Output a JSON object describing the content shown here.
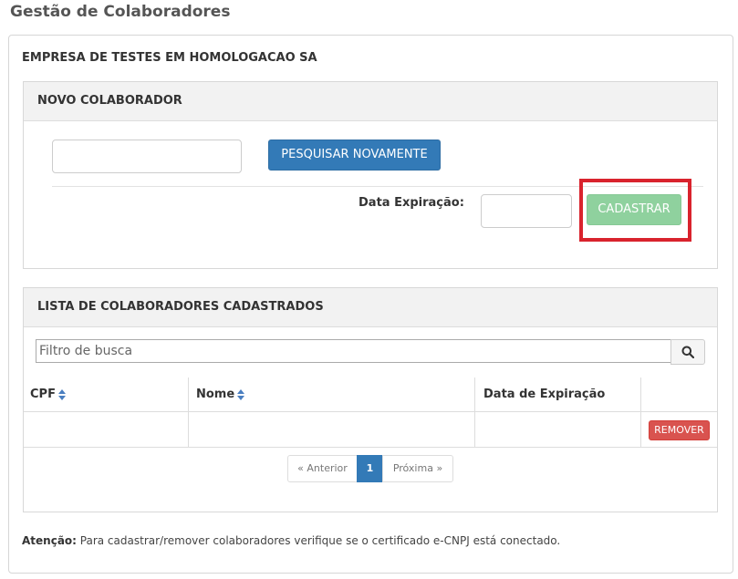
{
  "page": {
    "title": "Gestão de Colaboradores"
  },
  "company": {
    "name": "EMPRESA DE TESTES EM HOMOLOGACAO SA"
  },
  "new_collaborator": {
    "heading": "NOVO COLABORADOR",
    "search_value": "",
    "search_again_label": "PESQUISAR NOVAMENTE",
    "expiration_label": "Data Expiração:",
    "expiration_value": "",
    "register_label": "CADASTRAR"
  },
  "list": {
    "heading": "LISTA DE COLABORADORES CADASTRADOS",
    "filter_placeholder": "Filtro de busca",
    "columns": [
      "CPF",
      "Nome",
      "Data de Expiração"
    ],
    "rows": [
      {
        "cpf": "",
        "nome": "",
        "data_expiracao": "",
        "action_label": "REMOVER"
      }
    ],
    "pagination": {
      "previous": "« Anterior",
      "current": "1",
      "next": "Próxima »"
    }
  },
  "note": {
    "label": "Atenção:",
    "text": " Para cadastrar/remover colaboradores verifique se o certificado e-CNPJ está conectado."
  },
  "colors": {
    "primary": "#337ab7",
    "success_disabled": "#8fd19e",
    "danger": "#d9534f",
    "highlight": "#d9232d"
  },
  "icons": {
    "search": "search-icon",
    "sort": "sort-icon"
  }
}
